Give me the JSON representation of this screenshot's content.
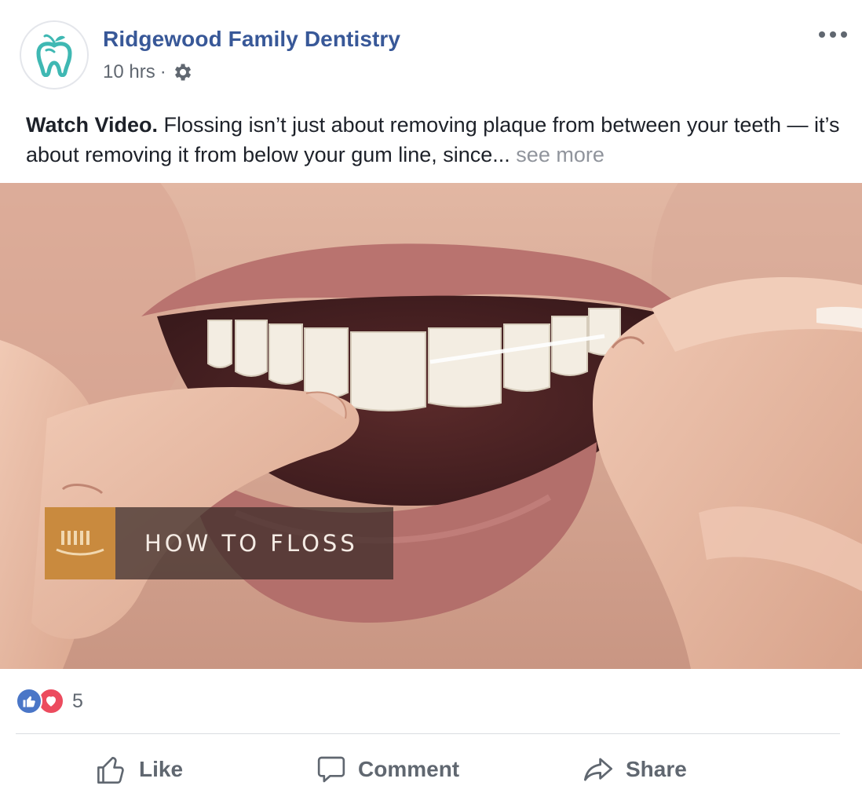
{
  "post": {
    "page_name": "Ridgewood Family Dentistry",
    "time": "10 hrs",
    "dot": "·",
    "privacy_icon": "gear-icon",
    "text_bold": "Watch Video.",
    "text_body": " Flossing isn’t just about removing plaque from between your teeth — it’s about removing it from below your gum line, since... ",
    "see_more": "see more"
  },
  "video": {
    "title_card": "HOW TO FLOSS",
    "card_color": "#c98a3e"
  },
  "reactions": {
    "icons": [
      "like-reaction-icon",
      "love-reaction-icon"
    ],
    "count": "5"
  },
  "actions": {
    "like": "Like",
    "comment": "Comment",
    "share": "Share"
  },
  "colors": {
    "page_name": "#385898",
    "secondary_text": "#606770",
    "brand_teal": "#3fb8b3",
    "like_blue": "#4a76c7",
    "love_red": "#ec4b5e"
  }
}
